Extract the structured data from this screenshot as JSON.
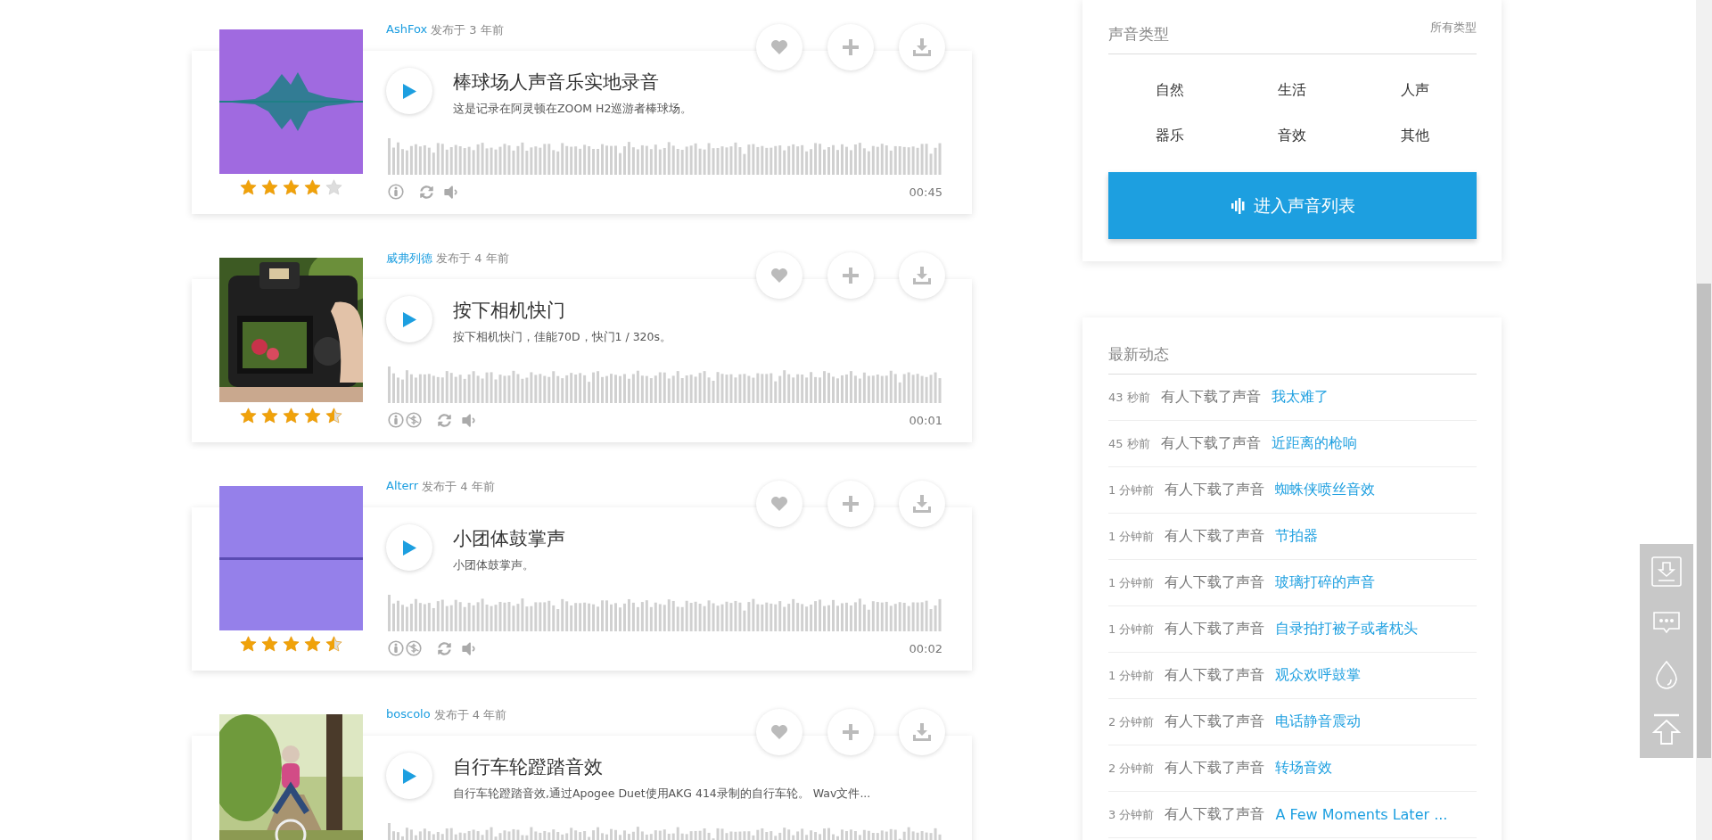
{
  "sounds": [
    {
      "author": "AshFox",
      "posted": "发布于 3 年前",
      "title": "棒球场人声音乐实地录音",
      "description": "这是记录在阿灵顿在ZOOM H2巡游者棒球场。",
      "duration": "00:45",
      "stars": 4,
      "licenses": [
        {
          "kind": "attribution"
        }
      ],
      "thumbnail": {
        "kind": "picture"
      }
    },
    {
      "author": "威弗列德",
      "posted": "发布于 4 年前",
      "title": "按下相机快门",
      "description": "按下相机快门，佳能70D，快门1 / 320s。",
      "duration": "00:01",
      "stars": 4.5,
      "licenses": [
        {
          "kind": "attribution"
        },
        {
          "kind": "noncommercial"
        }
      ],
      "thumbnail": {
        "kind": "picture"
      }
    },
    {
      "author": "Alterr",
      "posted": "发布于 4 年前",
      "title": "小团体鼓掌声",
      "description": "小团体鼓掌声。",
      "duration": "00:02",
      "stars": 4.5,
      "licenses": [
        {
          "kind": "attribution"
        },
        {
          "kind": "noncommercial"
        }
      ],
      "thumbnail": {
        "kind": "picture"
      }
    },
    {
      "author": "boscolo",
      "posted": "发布于 4 年前",
      "title": "自行车轮蹬踏音效",
      "description": "自行车轮蹬踏音效,通过Apogee Duet使用AKG 414录制的自行车轮。 Wav文件...",
      "thumbnail": {
        "kind": "picture"
      }
    }
  ],
  "categories": {
    "title": "声音类型",
    "all_link": "所有类型",
    "items": [
      "自然",
      "生活",
      "人声",
      "器乐",
      "音效",
      "其他"
    ],
    "button": "进入声音列表"
  },
  "activity": {
    "title": "最新动态",
    "rows": [
      {
        "time": "43 秒前",
        "action": "有人下载了声音",
        "sound": "我太难了"
      },
      {
        "time": "45 秒前",
        "action": "有人下载了声音",
        "sound": "近距离的枪响"
      },
      {
        "time": "1 分钟前",
        "action": "有人下载了声音",
        "sound": "蜘蛛侠喷丝音效"
      },
      {
        "time": "1 分钟前",
        "action": "有人下载了声音",
        "sound": "节拍器"
      },
      {
        "time": "1 分钟前",
        "action": "有人下载了声音",
        "sound": "玻璃打碎的声音"
      },
      {
        "time": "1 分钟前",
        "action": "有人下载了声音",
        "sound": "自录拍打被子或者枕头"
      },
      {
        "time": "1 分钟前",
        "action": "有人下载了声音",
        "sound": "观众欢呼鼓掌"
      },
      {
        "time": "2 分钟前",
        "action": "有人下载了声音",
        "sound": "电话静音震动"
      },
      {
        "time": "2 分钟前",
        "action": "有人下载了声音",
        "sound": "转场音效"
      },
      {
        "time": "3 分钟前",
        "action": "有人下载了声音",
        "sound": "A Few Moments Later ..."
      }
    ]
  }
}
